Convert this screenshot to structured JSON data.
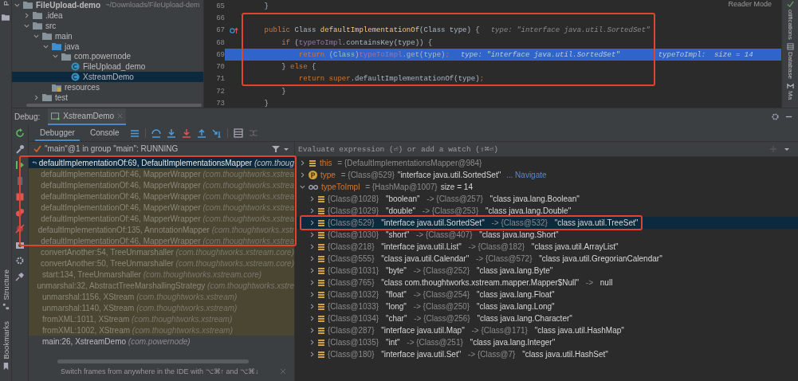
{
  "left_strip": {
    "top_label": "P",
    "bottom_tools": [
      {
        "label": "Structure",
        "kind": "structure"
      },
      {
        "label": "Bookmarks",
        "kind": "bookmarks"
      }
    ]
  },
  "right_strip": {
    "tools": [
      {
        "label": "otifications",
        "kind": "notifications"
      },
      {
        "label": "Database",
        "kind": "database"
      },
      {
        "label": "Ma",
        "kind": "maven"
      }
    ]
  },
  "project_tree": {
    "items": [
      {
        "label": "FileUpload-demo",
        "hint": "~/Downloads/FileUpload-dem",
        "kind": "module",
        "expanded": true,
        "selected": false,
        "children": [
          {
            "label": ".idea",
            "kind": "folder",
            "expanded": false,
            "selected": false
          },
          {
            "label": "src",
            "kind": "folder",
            "expanded": true,
            "selected": false,
            "children": [
              {
                "label": "main",
                "kind": "folder",
                "expanded": true,
                "selected": false,
                "children": [
                  {
                    "label": "java",
                    "kind": "source",
                    "expanded": true,
                    "selected": false,
                    "children": [
                      {
                        "label": "com.powernode",
                        "kind": "package",
                        "expanded": true,
                        "selected": false,
                        "children": [
                          {
                            "label": "FileUpload_demo",
                            "kind": "class",
                            "selected": false
                          },
                          {
                            "label": "XstreamDemo",
                            "kind": "class",
                            "selected": true
                          }
                        ]
                      }
                    ]
                  },
                  {
                    "label": "resources",
                    "kind": "resources",
                    "selected": false
                  }
                ]
              },
              {
                "label": "test",
                "kind": "folder",
                "expanded": false,
                "selected": false
              }
            ]
          }
        ]
      }
    ]
  },
  "editor": {
    "reader_mode": "Reader Mode",
    "lines": [
      {
        "number": "65",
        "current": false,
        "override_marker": false,
        "tokens": [
          {
            "kind": "plain",
            "t": "    }"
          }
        ]
      },
      {
        "number": "66",
        "current": false,
        "override_marker": false
      },
      {
        "number": "67",
        "current": false,
        "override_marker": true,
        "tokens": [
          {
            "kind": "kw",
            "t": "    public "
          },
          {
            "kind": "plain",
            "t": "Class "
          },
          {
            "kind": "method",
            "t": "defaultImplementationOf"
          },
          {
            "kind": "plain",
            "t": "(Class type) {"
          }
        ],
        "hints": [
          "type: \"interface java.util.SortedSet\""
        ]
      },
      {
        "number": "68",
        "current": false,
        "override_marker": false,
        "tokens": [
          {
            "kind": "kw",
            "t": "        if "
          },
          {
            "kind": "plain",
            "t": "("
          },
          {
            "kind": "field",
            "t": "typeToImpl"
          },
          {
            "kind": "plain",
            "t": ".containsKey(type)) {"
          }
        ]
      },
      {
        "number": "69",
        "current": true,
        "override_marker": false,
        "tokens": [
          {
            "kind": "kw",
            "t": "            return "
          },
          {
            "kind": "plain",
            "t": "(Class)"
          },
          {
            "kind": "field",
            "t": "typeToImpl"
          },
          {
            "kind": "plain",
            "t": ".get(type)"
          },
          {
            "kind": "kw",
            "t": ";"
          }
        ],
        "hints": [
          "type: \"interface java.util.SortedSet\"",
          "typeToImpl:  size = 14"
        ]
      },
      {
        "number": "70",
        "current": false,
        "override_marker": false,
        "tokens": [
          {
            "kind": "plain",
            "t": "        } "
          },
          {
            "kind": "kw",
            "t": "else "
          },
          {
            "kind": "plain",
            "t": "{"
          }
        ]
      },
      {
        "number": "71",
        "current": false,
        "override_marker": false,
        "tokens": [
          {
            "kind": "kw",
            "t": "            return super"
          },
          {
            "kind": "plain",
            "t": ".defaultImplementationOf(type)"
          },
          {
            "kind": "kw",
            "t": ";"
          }
        ]
      },
      {
        "number": "72",
        "current": false,
        "override_marker": false,
        "tokens": [
          {
            "kind": "plain",
            "t": "        }"
          }
        ]
      },
      {
        "number": "73",
        "current": false,
        "override_marker": false,
        "tokens": [
          {
            "kind": "plain",
            "t": "    }"
          }
        ]
      }
    ]
  },
  "debug": {
    "label": "Debug:",
    "tabs": [
      {
        "label": "XstreamDemo",
        "selected": true
      }
    ],
    "subtabs": [
      {
        "label": "Debugger",
        "selected": true
      },
      {
        "label": "Console",
        "selected": false
      }
    ],
    "thread": "\"main\"@1 in group \"main\": RUNNING",
    "frames": [
      {
        "method": "defaultImplementationOf:69, DefaultImplementationsMapper",
        "package": "(com.thoug",
        "selected": true,
        "library": false
      },
      {
        "method": "defaultImplementationOf:46, MapperWrapper",
        "package": "(com.thoughtworks.xstrea",
        "selected": false,
        "library": true
      },
      {
        "method": "defaultImplementationOf:46, MapperWrapper",
        "package": "(com.thoughtworks.xstrea",
        "selected": false,
        "library": true
      },
      {
        "method": "defaultImplementationOf:46, MapperWrapper",
        "package": "(com.thoughtworks.xstrea",
        "selected": false,
        "library": true
      },
      {
        "method": "defaultImplementationOf:46, MapperWrapper",
        "package": "(com.thoughtworks.xstrea",
        "selected": false,
        "library": true
      },
      {
        "method": "defaultImplementationOf:46, MapperWrapper",
        "package": "(com.thoughtworks.xstrea",
        "selected": false,
        "library": true
      },
      {
        "method": "defaultImplementationOf:135, AnnotationMapper",
        "package": "(com.thoughtworks.xstr",
        "selected": false,
        "library": true
      },
      {
        "method": "defaultImplementationOf:46, MapperWrapper",
        "package": "(com.thoughtworks.xstrea",
        "selected": false,
        "library": true
      },
      {
        "method": "convertAnother:54, TreeUnmarshaller",
        "package": "(com.thoughtworks.xstream.core)",
        "selected": false,
        "library": true
      },
      {
        "method": "convertAnother:50, TreeUnmarshaller",
        "package": "(com.thoughtworks.xstream.core)",
        "selected": false,
        "library": true
      },
      {
        "method": "start:134, TreeUnmarshaller",
        "package": "(com.thoughtworks.xstream.core)",
        "selected": false,
        "library": true
      },
      {
        "method": "unmarshal:32, AbstractTreeMarshallingStrategy",
        "package": "(com.thoughtworks.xstre",
        "selected": false,
        "library": true
      },
      {
        "method": "unmarshal:1156, XStream",
        "package": "(com.thoughtworks.xstream)",
        "selected": false,
        "library": true
      },
      {
        "method": "unmarshal:1140, XStream",
        "package": "(com.thoughtworks.xstream)",
        "selected": false,
        "library": true
      },
      {
        "method": "fromXML:1011, XStream",
        "package": "(com.thoughtworks.xstream)",
        "selected": false,
        "library": true
      },
      {
        "method": "fromXML:1002, XStream",
        "package": "(com.thoughtworks.xstream)",
        "selected": false,
        "library": true
      },
      {
        "method": "main:26, XstreamDemo",
        "package": "(com.powernode)",
        "selected": false,
        "library": false
      }
    ],
    "frames_hint": "Switch frames from anywhere in the IDE with ⌥⌘↑ and ⌥⌘↓",
    "evaluate": {
      "placeholder": "Evaluate expression (⏎) or add a watch (⇧⌘⏎)"
    },
    "variables": [
      {
        "kind": "object",
        "name": "this",
        "value": "= {DefaultImplementationsMapper@984}",
        "expanded": false
      },
      {
        "kind": "param",
        "name": "type",
        "value": "= {Class@529} ",
        "detail": "\"interface java.util.SortedSet\"",
        "link": "... Navigate",
        "expanded": false
      },
      {
        "kind": "map",
        "name": "typeToImpl",
        "value": "= {HashMap@1007}",
        "detail": " size = 14",
        "expanded": true,
        "children": [
          {
            "key_id": "{Class@1028}",
            "key": "\"boolean\"",
            "value_id": "-> {Class@257}",
            "value": "\"class java.lang.Boolean\"",
            "selected": false
          },
          {
            "key_id": "{Class@1029}",
            "key": "\"double\"",
            "value_id": "-> {Class@253}",
            "value": "\"class java.lang.Double\"",
            "selected": false
          },
          {
            "key_id": "{Class@529}",
            "key": "\"interface java.util.SortedSet\"",
            "value_id": "-> {Class@532}",
            "value": "\"class java.util.TreeSet\"",
            "selected": true
          },
          {
            "key_id": "{Class@1030}",
            "key": "\"short\"",
            "value_id": "-> {Class@407}",
            "value": "\"class java.lang.Short\"",
            "selected": false
          },
          {
            "key_id": "{Class@218}",
            "key": "\"interface java.util.List\"",
            "value_id": "-> {Class@182}",
            "value": "\"class java.util.ArrayList\"",
            "selected": false
          },
          {
            "key_id": "{Class@555}",
            "key": "\"class java.util.Calendar\"",
            "value_id": "-> {Class@572}",
            "value": "\"class java.util.GregorianCalendar\"",
            "selected": false
          },
          {
            "key_id": "{Class@1031}",
            "key": "\"byte\"",
            "value_id": "-> {Class@252}",
            "value": "\"class java.lang.Byte\"",
            "selected": false
          },
          {
            "key_id": "{Class@765}",
            "key": "\"class com.thoughtworks.xstream.mapper.Mapper$Null\"",
            "value_id": "->",
            "value": "null",
            "selected": false
          },
          {
            "key_id": "{Class@1032}",
            "key": "\"float\"",
            "value_id": "-> {Class@254}",
            "value": "\"class java.lang.Float\"",
            "selected": false
          },
          {
            "key_id": "{Class@1033}",
            "key": "\"long\"",
            "value_id": "-> {Class@250}",
            "value": "\"class java.lang.Long\"",
            "selected": false
          },
          {
            "key_id": "{Class@1034}",
            "key": "\"char\"",
            "value_id": "-> {Class@256}",
            "value": "\"class java.lang.Character\"",
            "selected": false
          },
          {
            "key_id": "{Class@287}",
            "key": "\"interface java.util.Map\"",
            "value_id": "-> {Class@171}",
            "value": "\"class java.util.HashMap\"",
            "selected": false
          },
          {
            "key_id": "{Class@1035}",
            "key": "\"int\"",
            "value_id": "-> {Class@251}",
            "value": "\"class java.lang.Integer\"",
            "selected": false
          },
          {
            "key_id": "{Class@180}",
            "key": "\"interface java.util.Set\"",
            "value_id": "-> {Class@7}",
            "value": "\"class java.util.HashSet\"",
            "selected": false
          }
        ]
      }
    ]
  }
}
